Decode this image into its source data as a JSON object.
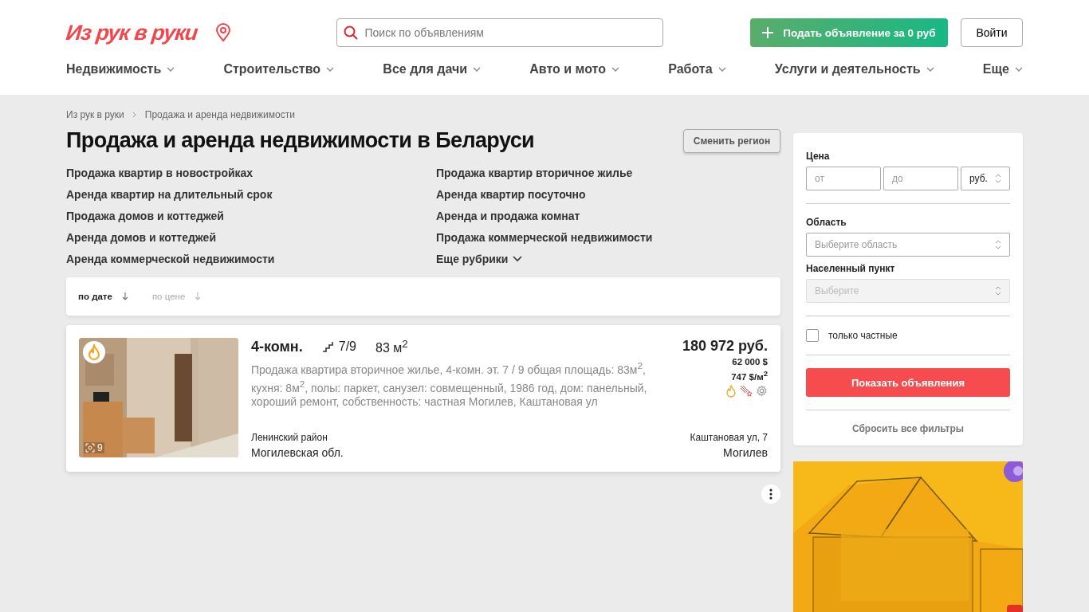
{
  "header": {
    "logo": "Из рук в руки",
    "search": {
      "placeholder": "Поиск по объявлениям"
    },
    "post_button": "Подать объявление за 0 руб",
    "login_button": "Войти"
  },
  "nav": [
    {
      "label": "Недвижимость"
    },
    {
      "label": "Строительство"
    },
    {
      "label": "Все для дачи"
    },
    {
      "label": "Авто и мото"
    },
    {
      "label": "Работа"
    },
    {
      "label": "Услуги и деятельность"
    },
    {
      "label": "Еще"
    }
  ],
  "breadcrumbs": [
    "Из рук в руки",
    "Продажа и аренда недвижимости"
  ],
  "title": "Продажа и аренда недвижимости в Беларуси",
  "change_region_button": "Сменить регион",
  "categories": [
    "Продажа квартир в новостройках",
    "Продажа квартир вторичное жилье",
    "Аренда квартир на длительный срок",
    "Аренда квартир посуточно",
    "Продажа домов и коттеджей",
    "Аренда и продажа комнат",
    "Аренда домов и коттеджей",
    "Продажа коммерческой недвижимости",
    "Аренда коммерческой недвижимости"
  ],
  "more_categories": "Еще рубрики",
  "sort": [
    {
      "label": "по дате",
      "selected": true
    },
    {
      "label": "по цене",
      "selected": false
    }
  ],
  "listings": [
    {
      "hot": true,
      "photo_count": "9",
      "rooms": "4-комн.",
      "floor": "7/9",
      "area": "83 м$^{2}$",
      "description": "Продажа квартира вторичное жилье, 4-комн. эт. 7 / 9 общая площадь: 83м$^{2}$, кухня: 8м$^{2}$, полы: паркет, санузел: совмещенный, 1986 год, дом: панельный, хороший ремонт, собственность: частная Могилев, Каштановая ул",
      "price": "180 972 руб.",
      "price_usd": "62 000 $",
      "price_per_m": "747 $/м$^{2}$",
      "district": "Ленинский район",
      "region": "Могилевская обл.",
      "street": "Каштановая ул, 7",
      "city": "Могилев"
    }
  ],
  "filters": {
    "price_label": "Цена",
    "price_from": {
      "placeholder": "от"
    },
    "price_to": {
      "placeholder": "до"
    },
    "currency": "руб.",
    "region_label": "Область",
    "region": {
      "placeholder": "Выберите область",
      "disabled": false
    },
    "locality_label": "Населенный пункт",
    "locality": {
      "placeholder": "Выберите",
      "disabled": true
    },
    "private_only": {
      "label": "только частные",
      "checked": false
    },
    "show_button": "Показать объявления",
    "reset": "Сбросить все фильтры"
  }
}
